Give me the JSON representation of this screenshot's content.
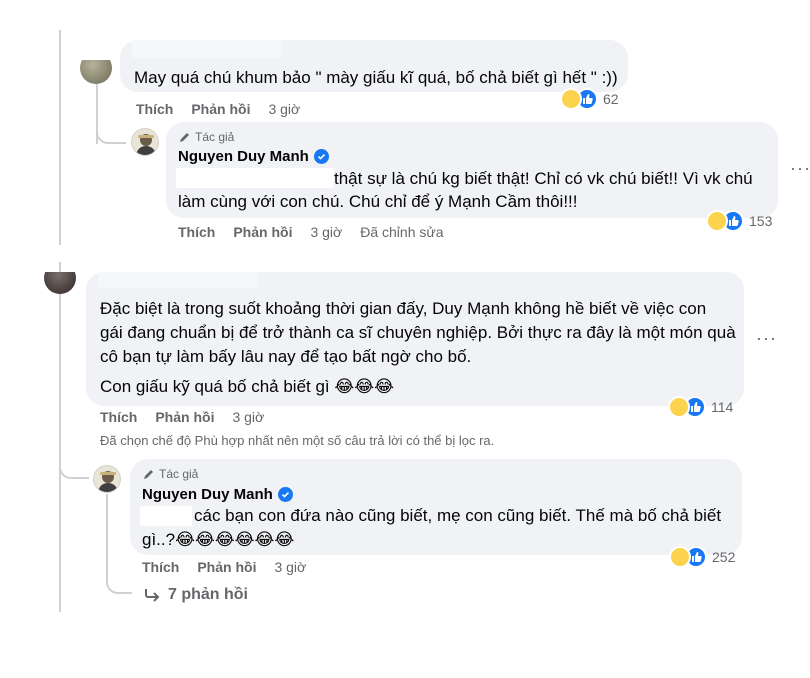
{
  "actions": {
    "like": "Thích",
    "reply": "Phản hồi"
  },
  "author_badge": "Tác giả",
  "comments": [
    {
      "text": "May quá chú khum bảo \" mày giấu kĩ quá, bố chả biết gì hết \" :))",
      "time": "3 giờ",
      "reaction_count": "62",
      "reply": {
        "name": "Nguyen Duy Manh",
        "line1": "thật sự là chú kg biết thật! Chỉ có vk chú biết!! Vì vk chú",
        "line2": "làm cùng với con chú. Chú chỉ để ý Mạnh Cầm thôi!!!",
        "time": "3 giờ",
        "edited": "Đã chỉnh sửa",
        "reaction_count": "153"
      }
    },
    {
      "line1": "Đặc biệt là trong suốt khoảng thời gian đấy, Duy Mạnh không hề biết về việc con",
      "line2": "gái đang chuẩn bị để trở thành ca sĩ chuyên nghiệp. Bởi thực ra đây là một món quà",
      "line3": "cô bạn tự làm bấy lâu nay để tạo bất ngờ cho bố.",
      "line4": "Con giấu kỹ quá bố chả biết gì",
      "time": "3 giờ",
      "reaction_count": "114",
      "filter_note": "Đã chọn chế độ Phù hợp nhất nên một số câu trả lời có thể bị lọc ra.",
      "reply": {
        "name": "Nguyen Duy Manh",
        "line1": "các bạn con đứa nào cũng biết, mẹ con cũng biết. Thế mà bố chả biết",
        "line2": "gì..?",
        "time": "3 giờ",
        "reaction_count": "252"
      },
      "more_replies": "7 phản hồi"
    }
  ],
  "emoji": {
    "laugh": "😂",
    "laugh3": "😂😂😂",
    "laugh6": "😂😂😂😂😂😂"
  },
  "more_dots": "···",
  "colors": {
    "bubble": "#f0f2f5",
    "meta": "#65676b",
    "verified": "#1877f2",
    "thread": "#ced0d4"
  }
}
